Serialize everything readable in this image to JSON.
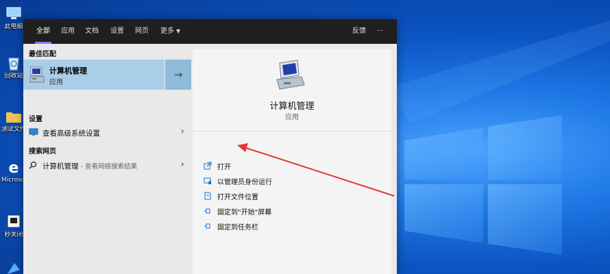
{
  "desktop": {
    "icons": [
      {
        "name": "this-pc",
        "label": "此电脑"
      },
      {
        "name": "recycle-bin",
        "label": "回收站"
      },
      {
        "name": "test-folder",
        "label": "测试文件"
      },
      {
        "name": "microsoft-edge",
        "label": "Microsoft Edge"
      },
      {
        "name": "app-shortcut",
        "label": "秒关闭"
      },
      {
        "name": "shortcut-bottom",
        "label": ""
      }
    ]
  },
  "search": {
    "tabs": [
      {
        "label": "全部",
        "active": true
      },
      {
        "label": "应用"
      },
      {
        "label": "文档"
      },
      {
        "label": "设置"
      },
      {
        "label": "网页"
      },
      {
        "label": "更多"
      }
    ],
    "feedback_label": "反馈",
    "more_options_label": "···"
  },
  "results": {
    "best_match_heading": "最佳匹配",
    "best_match": {
      "title": "计算机管理",
      "subtitle": "应用"
    },
    "settings_heading": "设置",
    "settings_item": "查看高级系统设置",
    "web_heading": "搜索网页",
    "web_item": "计算机管理",
    "web_item_suffix": " - 查看网络搜索结果"
  },
  "detail": {
    "app_name": "计算机管理",
    "app_type": "应用",
    "actions": [
      {
        "label": "打开",
        "icon": "open-icon"
      },
      {
        "label": "以管理员身份运行",
        "icon": "run-as-admin-icon"
      },
      {
        "label": "打开文件位置",
        "icon": "file-location-icon"
      },
      {
        "label": "固定到\"开始\"屏幕",
        "icon": "pin-start-icon"
      },
      {
        "label": "固定到任务栏",
        "icon": "pin-taskbar-icon"
      }
    ]
  },
  "colors": {
    "accent": "#7b7fff",
    "selection": "#aacde8",
    "annotation_arrow": "#e53935"
  }
}
